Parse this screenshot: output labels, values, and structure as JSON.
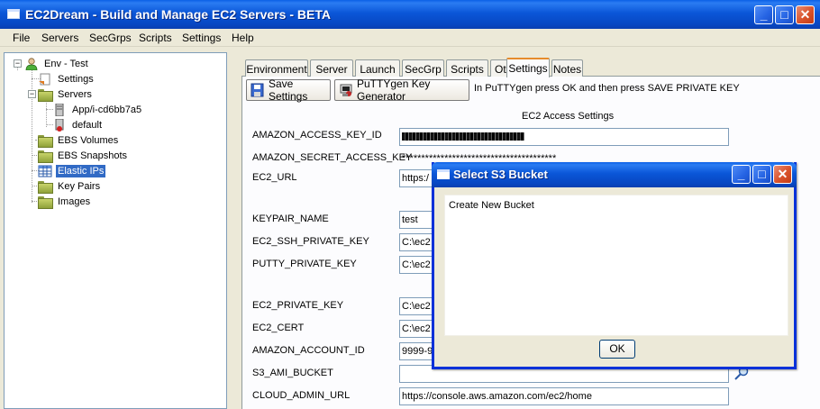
{
  "window": {
    "title": "EC2Dream - Build and Manage EC2 Servers - BETA",
    "controls": {
      "minimize": "_",
      "maximize": "□",
      "close": "✕"
    }
  },
  "menu": [
    "File",
    "Servers",
    "SecGrps",
    "Scripts",
    "Settings",
    "Help"
  ],
  "tree": {
    "root": "Env - Test",
    "settings": "Settings",
    "servers": "Servers",
    "server_1": "App/i-cd6bb7a5",
    "server_2": "default",
    "ebs_volumes": "EBS Volumes",
    "ebs_snapshots": "EBS Snapshots",
    "elastic_ips": "Elastic IPs",
    "key_pairs": "Key Pairs",
    "images": "Images",
    "expander_open": "−"
  },
  "tabs": [
    "Environment",
    "Server",
    "Launch",
    "SecGrp",
    "Scripts",
    "Other",
    "Settings",
    "Notes"
  ],
  "active_tab": "Settings",
  "toolbar": {
    "save_label": "Save Settings",
    "puttygen_label": "PuTTYgen Key Generator",
    "hint": "In PuTTYgen press OK and then press SAVE PRIVATE KEY"
  },
  "section_title": "EC2 Access Settings",
  "fields": {
    "access_key_label": "AMAZON_ACCESS_KEY_ID",
    "secret_key_label": "AMAZON_SECRET_ACCESS_KEY",
    "secret_key_value": "****************************************",
    "ec2_url_label": "EC2_URL",
    "ec2_url_value": "https:/",
    "keypair_label": "KEYPAIR_NAME",
    "keypair_value": "test",
    "ssh_key_label": "EC2_SSH_PRIVATE_KEY",
    "ssh_key_value": "C:\\ec2",
    "putty_key_label": "PUTTY_PRIVATE_KEY",
    "putty_key_value": "C:\\ec2",
    "private_key_label": "EC2_PRIVATE_KEY",
    "private_key_value": "C:\\ec2",
    "cert_label": "EC2_CERT",
    "cert_value": "C:\\ec2",
    "account_id_label": "AMAZON_ACCOUNT_ID",
    "account_id_value": "9999-9",
    "s3_bucket_label": "S3_AMI_BUCKET",
    "s3_bucket_value": "",
    "admin_url_label": "CLOUD_ADMIN_URL",
    "admin_url_value": "https://console.aws.amazon.com/ec2/home"
  },
  "dialog": {
    "title": "Select S3 Bucket",
    "items": [
      "Create New Bucket"
    ],
    "ok_label": "OK"
  },
  "colors": {
    "titlebar_blue": "#0a56d8",
    "selection": "#316ac5",
    "tab_highlight": "#e68b2c",
    "close_red": "#d9522a"
  }
}
